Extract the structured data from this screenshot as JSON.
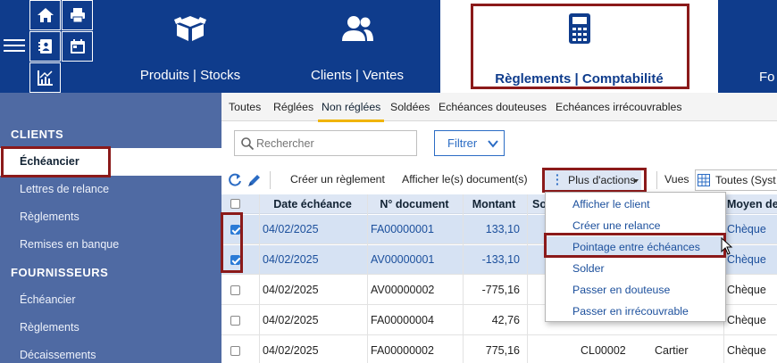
{
  "colors": {
    "topbar": "#0f3c8c",
    "sidebar": "#4f6aa3",
    "highlight": "#8b1a1a",
    "accent": "#2b6cc4",
    "tab_underline": "#f0b400"
  },
  "topbar": {
    "quick_icons": [
      "home-icon",
      "printer-icon",
      "address-book-icon",
      "calendar-icon",
      "chart-icon"
    ],
    "modules": [
      {
        "label": "Produits | Stocks",
        "icon": "box-icon"
      },
      {
        "label": "Clients | Ventes",
        "icon": "users-icon"
      },
      {
        "label": "Règlements | Comptabilité",
        "icon": "calculator-icon",
        "active": true
      },
      {
        "label": "Fo",
        "icon": ""
      }
    ]
  },
  "sidebar": {
    "sections": [
      {
        "title": "CLIENTS",
        "items": [
          "Échéancier",
          "Lettres de relance",
          "Règlements",
          "Remises en banque"
        ]
      },
      {
        "title": "FOURNISSEURS",
        "items": [
          "Échéancier",
          "Règlements",
          "Décaissements"
        ]
      }
    ],
    "active_item": "Échéancier"
  },
  "tabs": [
    "Toutes",
    "Réglées",
    "Non réglées",
    "Soldées",
    "Echéances douteuses",
    "Echéances irrécouvrables"
  ],
  "active_tab": "Non réglées",
  "search": {
    "placeholder": "Rechercher"
  },
  "filter": {
    "label": "Filtrer"
  },
  "toolbar": {
    "create": "Créer un règlement",
    "show_docs": "Afficher le(s) document(s)",
    "more_actions": "Plus d'actions",
    "views_label": "Vues",
    "views_value": "Toutes (Syst"
  },
  "table": {
    "columns": [
      "Date échéance",
      "N° document",
      "Montant",
      "So",
      "",
      "",
      "Moyen de"
    ],
    "rows": [
      {
        "checked": true,
        "date": "04/02/2025",
        "doc": "FA00000001",
        "amount": "133,10",
        "code": "",
        "name": "",
        "payment": "Chèque"
      },
      {
        "checked": true,
        "date": "04/02/2025",
        "doc": "AV00000001",
        "amount": "-133,10",
        "code": "",
        "name": "",
        "payment": "Chèque"
      },
      {
        "checked": false,
        "date": "04/02/2025",
        "doc": "AV00000002",
        "amount": "-775,16",
        "code": "",
        "name": "",
        "payment": "Chèque"
      },
      {
        "checked": false,
        "date": "04/02/2025",
        "doc": "FA00000004",
        "amount": "42,76",
        "code": "",
        "name": "",
        "payment": "Chèque"
      },
      {
        "checked": false,
        "date": "04/02/2025",
        "doc": "FA00000002",
        "amount": "775,16",
        "code": "CL00002",
        "name": "Cartier",
        "payment": "Chèque"
      }
    ]
  },
  "dropdown": {
    "items": [
      "Afficher le client",
      "Créer une relance",
      "Pointage entre échéances",
      "Solder",
      "Passer en douteuse",
      "Passer en irrécouvrable"
    ],
    "active": "Pointage entre échéances"
  }
}
